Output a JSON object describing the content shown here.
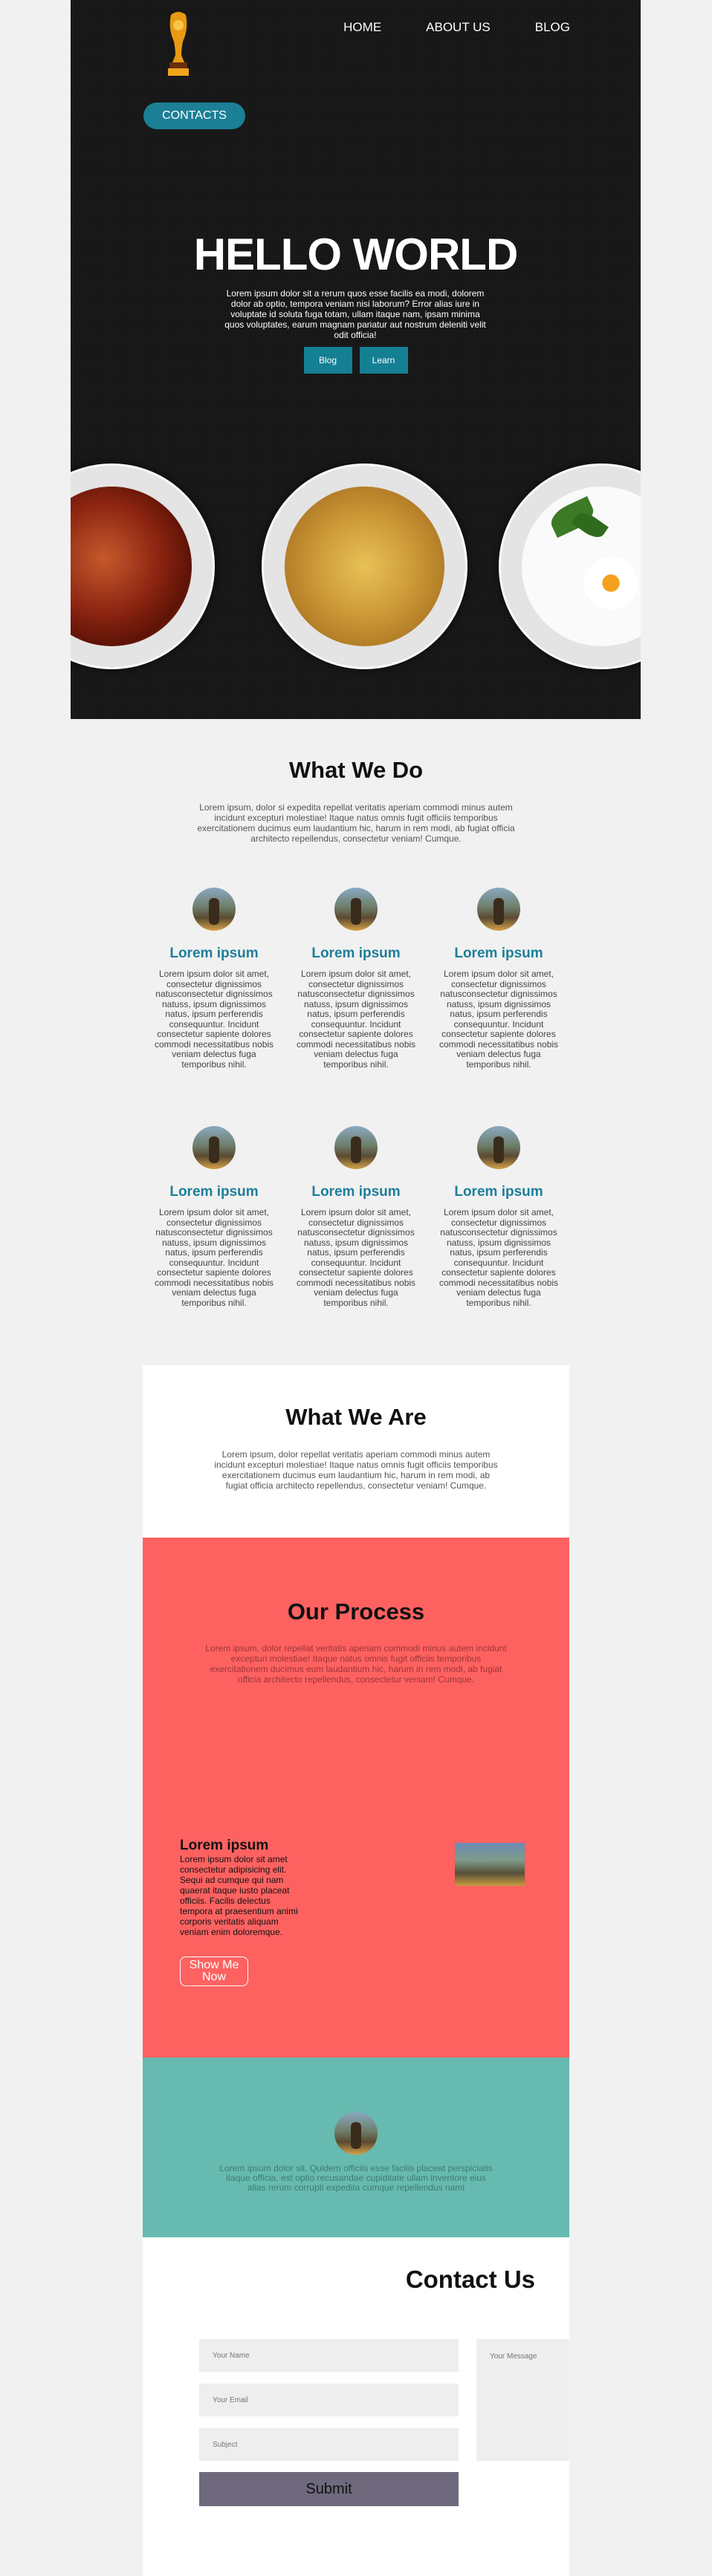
{
  "hero": {
    "nav": [
      "HOME",
      "ABOUT US",
      "BLOG"
    ],
    "contacts_label": "CONTACTS",
    "title": "HELLO WORLD",
    "text": "Lorem ipsum dolor sit a rerum quos esse facilis ea modi, dolorem dolor ab optio, tempora veniam nisi laborum? Error alias iure in voluptate id soluta fuga totam, ullam itaque nam, ipsam minima quos voluptates, earum magnam pariatur aut nostrum deleniti velit odit officia!",
    "buttons": [
      "Blog",
      "Learn"
    ]
  },
  "what_we_do": {
    "title": "What We Do",
    "intro": "Lorem ipsum, dolor si expedita repellat veritatis aperiam commodi minus autem incidunt excepturi molestiae! Itaque natus omnis fugit officiis temporibus exercitationem ducimus eum laudantium hic, harum in rem modi, ab fugiat officia architecto repellendus, consectetur veniam! Cumque.",
    "features": [
      {
        "title": "Lorem ipsum",
        "text": "Lorem ipsum dolor sit amet, consectetur dignissimos natusconsectetur dignissimos natuss, ipsum dignissimos natus, ipsum perferendis consequuntur. Incidunt consectetur sapiente dolores commodi necessitatibus nobis veniam delectus fuga temporibus nihil."
      },
      {
        "title": "Lorem ipsum",
        "text": "Lorem ipsum dolor sit amet, consectetur dignissimos natusconsectetur dignissimos natuss, ipsum dignissimos natus, ipsum perferendis consequuntur. Incidunt consectetur sapiente dolores commodi necessitatibus nobis veniam delectus fuga temporibus nihil."
      },
      {
        "title": "Lorem ipsum",
        "text": "Lorem ipsum dolor sit amet, consectetur dignissimos natusconsectetur dignissimos natuss, ipsum dignissimos natus, ipsum perferendis consequuntur. Incidunt consectetur sapiente dolores commodi necessitatibus nobis veniam delectus fuga temporibus nihil."
      },
      {
        "title": "Lorem ipsum",
        "text": "Lorem ipsum dolor sit amet, consectetur dignissimos natusconsectetur dignissimos natuss, ipsum dignissimos natus, ipsum perferendis consequuntur. Incidunt consectetur sapiente dolores commodi necessitatibus nobis veniam delectus fuga temporibus nihil."
      },
      {
        "title": "Lorem ipsum",
        "text": "Lorem ipsum dolor sit amet, consectetur dignissimos natusconsectetur dignissimos natuss, ipsum dignissimos natus, ipsum perferendis consequuntur. Incidunt consectetur sapiente dolores commodi necessitatibus nobis veniam delectus fuga temporibus nihil."
      },
      {
        "title": "Lorem ipsum",
        "text": "Lorem ipsum dolor sit amet, consectetur dignissimos natusconsectetur dignissimos natuss, ipsum dignissimos natus, ipsum perferendis consequuntur. Incidunt consectetur sapiente dolores commodi necessitatibus nobis veniam delectus fuga temporibus nihil."
      }
    ]
  },
  "what_we_are": {
    "title": "What We Are",
    "text": "Lorem ipsum, dolor repellat veritatis aperiam commodi minus autem incidunt excepturi molestiae! Itaque natus omnis fugit officiis temporibus exercitationem ducimus eum laudantium hic, harum in rem modi, ab fugiat officia architecto repellendus, consectetur veniam! Cumque."
  },
  "process": {
    "title": "Our Process",
    "intro": "Lorem ipsum, dolor repellat veritatis aperiam commodi minus autem incidunt excepturi molestiae! Itaque natus omnis fugit officiis temporibus exercitationem ducimus eum laudantium hic, harum in rem modi, ab fugiat officia architecto repellendus, consectetur veniam! Cumque.",
    "heading": "Lorem ipsum",
    "text": "Lorem ipsum dolor sit amet consectetur adipisicing elit. Sequi ad cumque qui nam quaerat itaque iusto placeat officiis. Facilis delectus tempora at praesentium animi corporis veritatis aliquam veniam enim doloremque.",
    "button": "Show Me Now"
  },
  "testimonial": {
    "text": "Lorem ipsum dolor sit. Quidem officiis esse facilis placeat perspiciatis itaque officia, est optio recusandae cupiditate ullam inventore eius alias rerum corrupti expedita cumque repellendus nami"
  },
  "contact": {
    "title": "Contact Us",
    "name_placeholder": "Your Name",
    "email_placeholder": "Your Email",
    "subject_placeholder": "Subject",
    "message_placeholder": "Your Message",
    "submit": "Submit"
  },
  "colors": {
    "accent": "#1b7f96",
    "process_bg": "#fd6261",
    "teal_bg": "#67bab0",
    "submit_bg": "#6f697d"
  }
}
